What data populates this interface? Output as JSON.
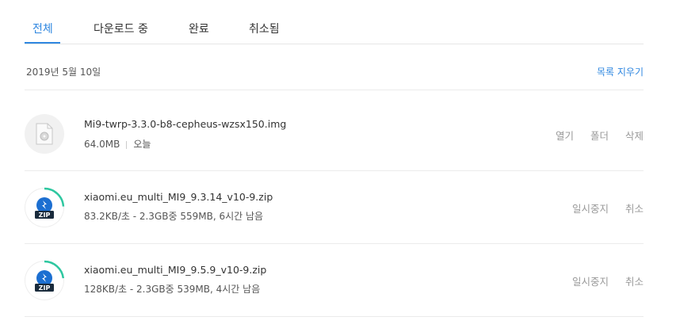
{
  "tabs": [
    {
      "label": "전체"
    },
    {
      "label": "다운로드 중"
    },
    {
      "label": "완료"
    },
    {
      "label": "취소됨"
    }
  ],
  "date_header": "2019년 5월 10일",
  "clear_list": "목록 지우기",
  "items": [
    {
      "icon": "disk-image-file-icon",
      "name": "Mi9-twrp-3.3.0-b8-cepheus-wzsx150.img",
      "size": "64.0MB",
      "date": "오늘",
      "actions": [
        "열기",
        "폴더",
        "삭제"
      ]
    },
    {
      "icon": "zip-file-icon",
      "name": "xiaomi.eu_multi_MI9_9.3.14_v10-9.zip",
      "status": "83.2KB/초 - 2.3GB중 559MB, 6시간 남음",
      "progress": 0.24,
      "zip_label": "ZIP",
      "actions": [
        "일시중지",
        "취소"
      ]
    },
    {
      "icon": "zip-file-icon",
      "name": "xiaomi.eu_multi_MI9_9.5.9_v10-9.zip",
      "status": "128KB/초 - 2.3GB중 539MB, 4시간 남음",
      "progress": 0.23,
      "zip_label": "ZIP",
      "actions": [
        "일시중지",
        "취소"
      ]
    }
  ],
  "colors": {
    "accent": "#2f87e0",
    "progress": "#2ec7a0",
    "zip_blue": "#1c6fd1"
  }
}
